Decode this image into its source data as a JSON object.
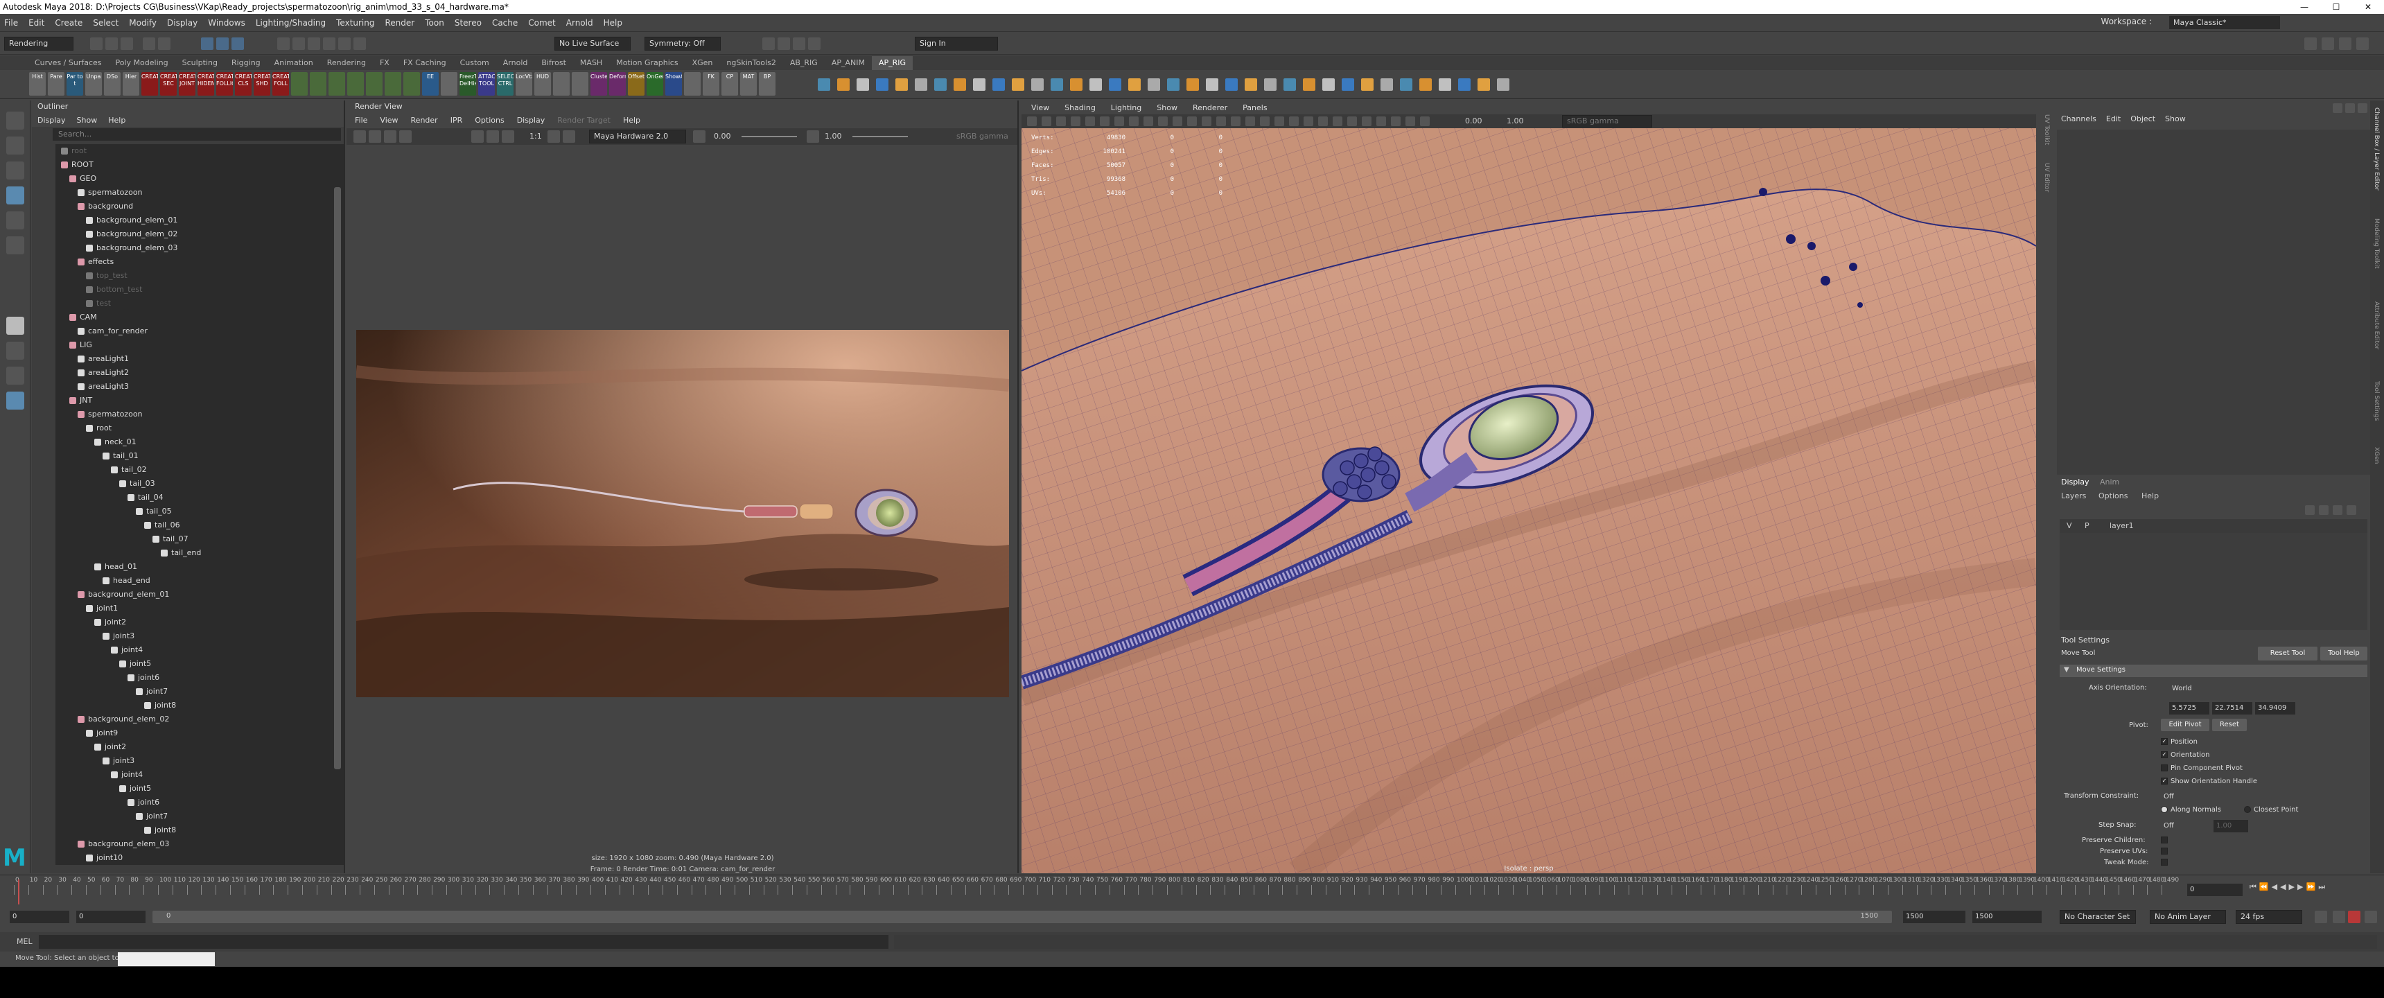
{
  "window": {
    "title": "Autodesk Maya 2018: D:\\Projects CG\\Business\\VKap\\Ready_projects\\spermatozoon\\rig_anim\\mod_33_s_04_hardware.ma*",
    "minimize": "—",
    "maximize": "☐",
    "close": "✕"
  },
  "menubar": {
    "items": [
      "File",
      "Edit",
      "Create",
      "Select",
      "Modify",
      "Display",
      "Windows",
      "Lighting/Shading",
      "Texturing",
      "Render",
      "Toon",
      "Stereo",
      "Cache",
      "Comet",
      "Arnold",
      "Help"
    ],
    "workspace_label": "Workspace :",
    "workspace_value": "Maya Classic*"
  },
  "statusline": {
    "mode": "Rendering",
    "live_surface": "No Live Surface",
    "symmetry": "Symmetry: Off",
    "sign_in": "Sign In"
  },
  "shelf": {
    "tabs": [
      "Curves / Surfaces",
      "Poly Modeling",
      "Sculpting",
      "Rigging",
      "Animation",
      "Rendering",
      "FX",
      "FX Caching",
      "Custom",
      "Arnold",
      "Bifrost",
      "MASH",
      "Motion Graphics",
      "XGen",
      "ngSkinTools2",
      "AB_RIG",
      "AP_ANIM",
      "AP_RIG"
    ],
    "active_tab": "AP_RIG",
    "buttons": [
      "Hist",
      "Pare",
      "Par to t",
      "Unpa",
      "DSo",
      "Hier",
      "CREAT",
      "CREAT SEC",
      "CREAT JOINT",
      "CREAT HIDENT",
      "CREAT FOLLIC",
      "CREAT CLS",
      "CREAT SHD",
      "CREAT FOLL",
      "",
      "",
      "",
      "",
      "",
      "",
      "",
      "EE",
      "",
      "FreezT DelHist",
      "ATTACH TOOL",
      "SELECT CTRL",
      "LocVtx",
      "HUD",
      "",
      "",
      "Cluster",
      "Deform",
      "Offset",
      "OnGen",
      "ShowAt",
      "",
      "FK",
      "CP",
      "MAT",
      "BP"
    ]
  },
  "outliner": {
    "title": "Outliner",
    "menu": [
      "Display",
      "Show",
      "Help"
    ],
    "search_placeholder": "Search...",
    "items": [
      {
        "label": "root",
        "depth": 0,
        "dim": true,
        "color": "#888"
      },
      {
        "label": "ROOT",
        "depth": 0,
        "color": "#d9a"
      },
      {
        "label": "GEO",
        "depth": 1,
        "color": "#d9a"
      },
      {
        "label": "spermatozoon",
        "depth": 2,
        "color": "#ddd"
      },
      {
        "label": "background",
        "depth": 2,
        "color": "#d9a"
      },
      {
        "label": "background_elem_01",
        "depth": 3,
        "color": "#ddd"
      },
      {
        "label": "background_elem_02",
        "depth": 3,
        "color": "#ddd"
      },
      {
        "label": "background_elem_03",
        "depth": 3,
        "color": "#ddd"
      },
      {
        "label": "effects",
        "depth": 2,
        "color": "#d9a"
      },
      {
        "label": "top_test",
        "depth": 3,
        "dim": true,
        "color": "#777"
      },
      {
        "label": "bottom_test",
        "depth": 3,
        "dim": true,
        "color": "#777"
      },
      {
        "label": "test",
        "depth": 3,
        "dim": true,
        "color": "#777"
      },
      {
        "label": "CAM",
        "depth": 1,
        "color": "#d9a"
      },
      {
        "label": "cam_for_render",
        "depth": 2,
        "color": "#ddd"
      },
      {
        "label": "LIG",
        "depth": 1,
        "color": "#d9a"
      },
      {
        "label": "areaLight1",
        "depth": 2,
        "color": "#ddd"
      },
      {
        "label": "areaLight2",
        "depth": 2,
        "color": "#ddd"
      },
      {
        "label": "areaLight3",
        "depth": 2,
        "color": "#ddd"
      },
      {
        "label": "JNT",
        "depth": 1,
        "color": "#d9a"
      },
      {
        "label": "spermatozoon",
        "depth": 2,
        "color": "#d9a"
      },
      {
        "label": "root",
        "depth": 3,
        "color": "#ddd"
      },
      {
        "label": "neck_01",
        "depth": 4,
        "color": "#ddd"
      },
      {
        "label": "tail_01",
        "depth": 5,
        "color": "#ddd"
      },
      {
        "label": "tail_02",
        "depth": 6,
        "color": "#ddd"
      },
      {
        "label": "tail_03",
        "depth": 7,
        "color": "#ddd"
      },
      {
        "label": "tail_04",
        "depth": 8,
        "color": "#ddd"
      },
      {
        "label": "tail_05",
        "depth": 9,
        "color": "#ddd"
      },
      {
        "label": "tail_06",
        "depth": 10,
        "color": "#ddd"
      },
      {
        "label": "tail_07",
        "depth": 11,
        "color": "#ddd"
      },
      {
        "label": "tail_end",
        "depth": 12,
        "color": "#ddd"
      },
      {
        "label": "head_01",
        "depth": 4,
        "color": "#ddd"
      },
      {
        "label": "head_end",
        "depth": 5,
        "color": "#ddd"
      },
      {
        "label": "background_elem_01",
        "depth": 2,
        "color": "#d9a"
      },
      {
        "label": "joint1",
        "depth": 3,
        "color": "#ddd"
      },
      {
        "label": "joint2",
        "depth": 4,
        "color": "#ddd"
      },
      {
        "label": "joint3",
        "depth": 5,
        "color": "#ddd"
      },
      {
        "label": "joint4",
        "depth": 6,
        "color": "#ddd"
      },
      {
        "label": "joint5",
        "depth": 7,
        "color": "#ddd"
      },
      {
        "label": "joint6",
        "depth": 8,
        "color": "#ddd"
      },
      {
        "label": "joint7",
        "depth": 9,
        "color": "#ddd"
      },
      {
        "label": "joint8",
        "depth": 10,
        "color": "#ddd"
      },
      {
        "label": "background_elem_02",
        "depth": 2,
        "color": "#d9a"
      },
      {
        "label": "joint9",
        "depth": 3,
        "color": "#ddd"
      },
      {
        "label": "joint2",
        "depth": 4,
        "color": "#ddd"
      },
      {
        "label": "joint3",
        "depth": 5,
        "color": "#ddd"
      },
      {
        "label": "joint4",
        "depth": 6,
        "color": "#ddd"
      },
      {
        "label": "joint5",
        "depth": 7,
        "color": "#ddd"
      },
      {
        "label": "joint6",
        "depth": 8,
        "color": "#ddd"
      },
      {
        "label": "joint7",
        "depth": 9,
        "color": "#ddd"
      },
      {
        "label": "joint8",
        "depth": 10,
        "color": "#ddd"
      },
      {
        "label": "background_elem_03",
        "depth": 2,
        "color": "#d9a"
      },
      {
        "label": "joint10",
        "depth": 3,
        "color": "#ddd"
      }
    ]
  },
  "render_view": {
    "title": "Render View",
    "menu": [
      "File",
      "View",
      "Render",
      "IPR",
      "Options",
      "Display",
      "Render Target",
      "Help"
    ],
    "renderer": "Maya Hardware 2.0",
    "exposure": "0.00",
    "gamma": "1.00",
    "ratio": "1:1",
    "view_transform": "sRGB gamma",
    "info_line1": "size: 1920 x 1080  zoom: 0.490          (Maya Hardware 2.0)",
    "info_line2": "Frame: 0      Render Time: 0:01      Camera: cam_for_render"
  },
  "viewport": {
    "menu": [
      "View",
      "Shading",
      "Lighting",
      "Show",
      "Renderer",
      "Panels"
    ],
    "exposure": "0.00",
    "gamma": "1.00",
    "color_space": "sRGB gamma",
    "hud": [
      {
        "k": "Verts:",
        "v": "49830",
        "a": "0",
        "b": "0"
      },
      {
        "k": "Edges:",
        "v": "100241",
        "a": "0",
        "b": "0"
      },
      {
        "k": "Faces:",
        "v": "50057",
        "a": "0",
        "b": "0"
      },
      {
        "k": "Tris:",
        "v": "99368",
        "a": "0",
        "b": "0"
      },
      {
        "k": "UVs:",
        "v": "54106",
        "a": "0",
        "b": "0"
      }
    ],
    "camera_label": "Isolate : persp"
  },
  "channel_box": {
    "menu": [
      "Channels",
      "Edit",
      "Object",
      "Show"
    ],
    "side_labels": [
      "UV Toolkit",
      "UV Editor"
    ],
    "display_tabs": [
      "Display",
      "Anim"
    ],
    "layer_menu": [
      "Layers",
      "Options",
      "Help"
    ],
    "layer_row": {
      "v": "V",
      "p": "P",
      "name": "layer1"
    }
  },
  "tool_settings": {
    "title": "Tool Settings",
    "tool_name": "Move Tool",
    "reset_button": "Reset Tool",
    "help_button": "Tool Help",
    "section": "Move Settings",
    "axis_orientation_label": "Axis Orientation:",
    "axis_orientation_value": "World",
    "coords": [
      "5.5725",
      "22.7514",
      "34.9409"
    ],
    "pivot_label": "Pivot:",
    "edit_pivot": "Edit Pivot",
    "reset": "Reset",
    "checks": [
      {
        "label": "Position",
        "checked": true
      },
      {
        "label": "Orientation",
        "checked": true
      },
      {
        "label": "Pin Component Pivot",
        "checked": false
      },
      {
        "label": "Show Orientation Handle",
        "checked": true
      }
    ],
    "transform_constraint_label": "Transform Constraint:",
    "transform_constraint_value": "Off",
    "along_normals": "Along Normals",
    "closest_point": "Closest Point",
    "step_snap_label": "Step Snap:",
    "step_snap_value": "Off",
    "step_snap_num": "1.00",
    "preserve_children": "Preserve Children:",
    "preserve_uvs": "Preserve UVs:",
    "tweak_mode": "Tweak Mode:"
  },
  "right_tabs": [
    "Channel Box / Layer Editor",
    "Modeling Toolkit",
    "Attribute Editor",
    "Tool Settings",
    "XGen"
  ],
  "timeline": {
    "ticks": [
      "0",
      "10",
      "20",
      "30",
      "40",
      "50",
      "60",
      "70",
      "80",
      "90",
      "100",
      "110",
      "120",
      "130",
      "140",
      "150",
      "160",
      "170",
      "180",
      "190",
      "200",
      "210",
      "220",
      "230",
      "240",
      "250",
      "260",
      "270",
      "280",
      "290",
      "300",
      "310",
      "320",
      "330",
      "340",
      "350",
      "360",
      "370",
      "380",
      "390",
      "400",
      "410",
      "420",
      "430",
      "440",
      "450",
      "460",
      "470",
      "480",
      "490",
      "500",
      "510",
      "520",
      "530",
      "540",
      "550",
      "560",
      "570",
      "580",
      "590",
      "600",
      "610",
      "620",
      "630",
      "640",
      "650",
      "660",
      "670",
      "680",
      "690",
      "700",
      "710",
      "720",
      "730",
      "740",
      "750",
      "760",
      "770",
      "780",
      "790",
      "800",
      "810",
      "820",
      "830",
      "840",
      "850",
      "860",
      "870",
      "880",
      "890",
      "900",
      "910",
      "920",
      "930",
      "940",
      "950",
      "960",
      "970",
      "980",
      "990",
      "1000",
      "1010",
      "1020",
      "1030",
      "1040",
      "1050",
      "1060",
      "1070",
      "1080",
      "1090",
      "1100",
      "1110",
      "1120",
      "1130",
      "1140",
      "1150",
      "1160",
      "1170",
      "1180",
      "1190",
      "1200",
      "1210",
      "1220",
      "1230",
      "1240",
      "1250",
      "1260",
      "1270",
      "1280",
      "1290",
      "1300",
      "1310",
      "1320",
      "1330",
      "1340",
      "1350",
      "1360",
      "1370",
      "1380",
      "1390",
      "1400",
      "1410",
      "1420",
      "1430",
      "1440",
      "1450",
      "1460",
      "1470",
      "1480",
      "1490"
    ],
    "current_frame": "0"
  },
  "range": {
    "start": "0",
    "start2": "0",
    "slider_start": "0",
    "slider_end": "1500",
    "end": "1500",
    "end2": "1500",
    "character_set": "No Character Set",
    "anim_layer": "No Anim Layer",
    "fps": "24 fps"
  },
  "mel": {
    "label": "MEL"
  },
  "help_line": "Move Tool: Select an object to drag."
}
